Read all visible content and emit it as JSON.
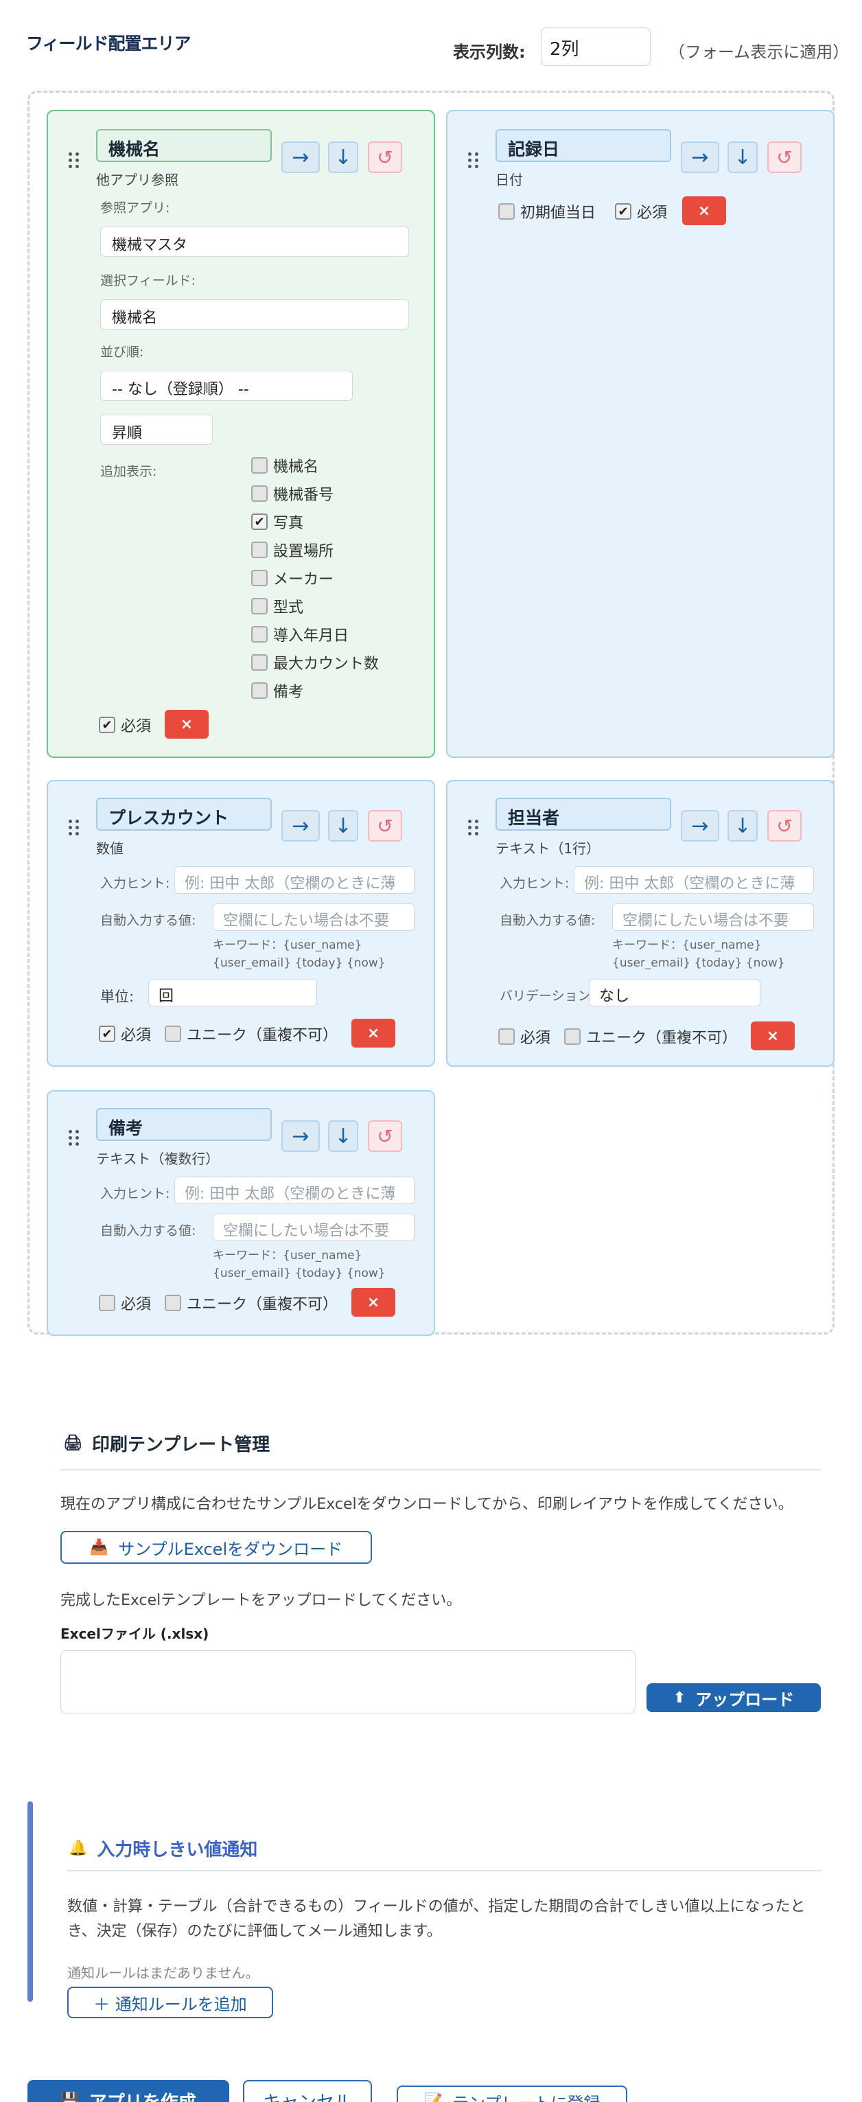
{
  "header": {
    "title": "フィールド配置エリア",
    "cols_label": "表示列数:",
    "cols_value": "2列",
    "cols_note": "（フォーム表示に適用）"
  },
  "buttons": {
    "right": "→",
    "down": "↓",
    "reset": "↺",
    "delete": "×"
  },
  "fields": {
    "machine": {
      "name": "機械名",
      "type": "他アプリ参照",
      "ref_app_label": "参照アプリ:",
      "ref_app_value": "機械マスタ",
      "select_field_label": "選択フィールド:",
      "select_field_value": "機械名",
      "sort_label": "並び順:",
      "sort_value": "-- なし（登録順） --",
      "order_value": "昇順",
      "extra_label": "追加表示:",
      "extra_options": [
        "機械名",
        "機械番号",
        "写真",
        "設置場所",
        "メーカー",
        "型式",
        "導入年月日",
        "最大カウント数",
        "備考"
      ],
      "extra_checked": [
        false,
        false,
        true,
        false,
        false,
        false,
        false,
        false,
        false
      ],
      "required_label": "必須",
      "required_checked": true
    },
    "date": {
      "name": "記録日",
      "type": "日付",
      "default_today_label": "初期値当日",
      "default_today_checked": false,
      "required_label": "必須",
      "required_checked": true
    },
    "press": {
      "name": "プレスカウント",
      "type": "数値",
      "hint_label": "入力ヒント:",
      "hint_placeholder": "例: 田中 太郎（空欄のときに薄",
      "auto_label": "自動入力する値:",
      "auto_placeholder": "空欄にしたい場合は不要",
      "keywords_1": "キーワード：{user_name}",
      "keywords_2": "{user_email} {today} {now}",
      "unit_label": "単位:",
      "unit_value": "回",
      "required_label": "必須",
      "required_checked": true,
      "unique_label": "ユニーク（重複不可）",
      "unique_checked": false
    },
    "person": {
      "name": "担当者",
      "type": "テキスト（1行）",
      "hint_label": "入力ヒント:",
      "hint_placeholder": "例: 田中 太郎（空欄のときに薄",
      "auto_label": "自動入力する値:",
      "auto_placeholder": "空欄にしたい場合は不要",
      "keywords_1": "キーワード：{user_name}",
      "keywords_2": "{user_email} {today} {now}",
      "validation_label": "バリデーション:",
      "validation_value": "なし",
      "required_label": "必須",
      "required_checked": false,
      "unique_label": "ユニーク（重複不可）",
      "unique_checked": false
    },
    "note": {
      "name": "備考",
      "type": "テキスト（複数行）",
      "hint_label": "入力ヒント:",
      "hint_placeholder": "例: 田中 太郎（空欄のときに薄",
      "auto_label": "自動入力する値:",
      "auto_placeholder": "空欄にしたい場合は不要",
      "keywords_1": "キーワード：{user_name}",
      "keywords_2": "{user_email} {today} {now}",
      "required_label": "必須",
      "required_checked": false,
      "unique_label": "ユニーク（重複不可）",
      "unique_checked": false
    }
  },
  "print": {
    "title": "印刷テンプレート管理",
    "desc": "現在のアプリ構成に合わせたサンプルExcelをダウンロードしてから、印刷レイアウトを作成してください。",
    "download_label": "サンプルExcelをダウンロード",
    "upload_desc": "完成したExcelテンプレートをアップロードしてください。",
    "file_label": "Excelファイル (.xlsx)",
    "upload_label": "アップロード"
  },
  "notify": {
    "title": "入力時しきい値通知",
    "desc_1": "数値・計算・テーブル（合計できるもの）フィールドの値が、指定した期間の合計でしきい値以上になったと",
    "desc_2": "き、決定（保存）のたびに評価してメール通知します。",
    "empty": "通知ルールはまだありません。",
    "add_label": "＋ 通知ルールを追加"
  },
  "footer": {
    "create_label": "アプリを作成",
    "cancel_label": "キャンセル",
    "template_label": "テンプレートに登録"
  },
  "colors": {
    "primary": "#2066b3",
    "danger": "#e84b3c",
    "green_card": "#eaf6ee",
    "blue_card": "#e7f3fc"
  },
  "icons": {
    "printer": "printer-icon",
    "download": "download-icon",
    "upload": "upload-icon",
    "bell": "bell-icon",
    "save": "floppy-disk-icon",
    "template": "document-icon"
  }
}
